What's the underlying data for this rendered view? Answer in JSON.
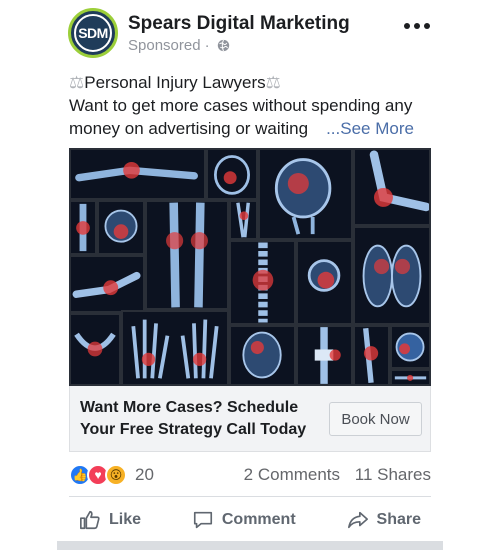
{
  "header": {
    "avatar_text": "SDM",
    "page_name": "Spears Digital Marketing",
    "sponsored": "Sponsored"
  },
  "post": {
    "line1": "Personal Injury Lawyers",
    "line2": "Want to get more cases without spending any",
    "line3": "money on advertising or waiting",
    "see_more": "...See More"
  },
  "image": {
    "description_icon": "xray-collage-image"
  },
  "cta": {
    "headline_line1": "Want More Cases? Schedule",
    "headline_line2": "Your Free Strategy Call Today",
    "button_label": "Book Now"
  },
  "stats": {
    "reaction_count": "20",
    "comments": "2 Comments",
    "shares": "11 Shares"
  },
  "actions": {
    "like": "Like",
    "comment": "Comment",
    "share": "Share"
  },
  "colors": {
    "link": "#4b6ea8",
    "avatar_bg": "#1f3c5a",
    "avatar_ring": "#9ccf3a",
    "xray_glow": "#e23a3a"
  }
}
